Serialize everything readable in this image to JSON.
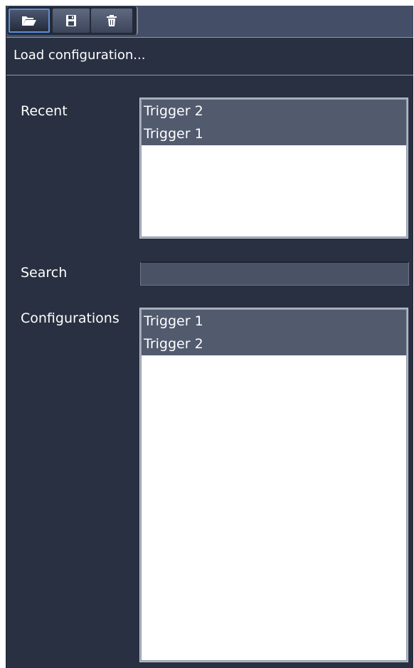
{
  "toolbar": {
    "buttons": [
      {
        "icon": "folder-open-icon",
        "active": true
      },
      {
        "icon": "save-icon",
        "active": false
      },
      {
        "icon": "delete-icon",
        "active": false
      }
    ]
  },
  "header": {
    "title": "Load configuration..."
  },
  "recent": {
    "label": "Recent",
    "items": [
      "Trigger 2",
      "Trigger 1"
    ]
  },
  "search": {
    "label": "Search",
    "value": "",
    "placeholder": ""
  },
  "configurations": {
    "label": "Configurations",
    "items": [
      "Trigger 1",
      "Trigger 2"
    ]
  },
  "colors": {
    "panel_bg": "#283041",
    "toolbar_bg": "#444e66",
    "selected_item_bg": "#525a6e",
    "active_border": "#5a8fd8"
  }
}
